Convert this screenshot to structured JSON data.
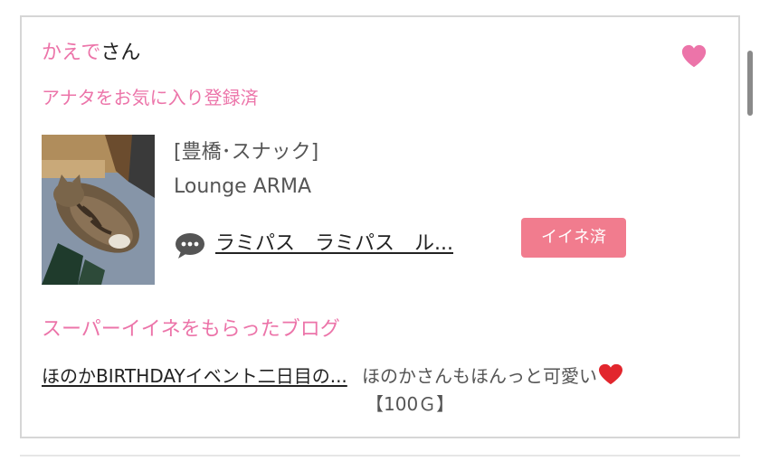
{
  "post": {
    "user_name": "かえで",
    "honorific": "さん",
    "favorite_status": "アナタをお気に入り登録済",
    "favorite_icon": "heart-icon",
    "accent_color": "#ec74a9",
    "shop": {
      "category": "[豊橋･スナック]",
      "name": "Lounge ARMA",
      "comment": "ラミパス　ラミパス　ル...",
      "like_badge": "イイネ済",
      "photo": "cat-photo"
    },
    "blog": {
      "heading": "スーパーイイネをもらったブログ",
      "title": "ほのかBIRTHDAYイベント二日目の...",
      "comment": "ほのかさんもほんっと可愛い",
      "points": "【100Ｇ】"
    }
  }
}
